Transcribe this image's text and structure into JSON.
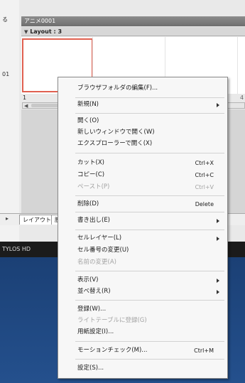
{
  "app": {
    "left_labels": [
      "る",
      "01"
    ],
    "title": "アニメ0001",
    "layout_label": "Layout : 3",
    "frame_number": "1",
    "frame_number_right": "4",
    "tab_label": "レイアウト",
    "tab2_label": "腕",
    "status_text": "TYLOS HD"
  },
  "context_menu": {
    "items": [
      {
        "label": "ブラウザフォルダの編集(F)...",
        "shortcut": "",
        "submenu": false,
        "disabled": false
      },
      {
        "label": "新規(N)",
        "shortcut": "",
        "submenu": true,
        "disabled": false
      },
      {
        "label": "開く(O)",
        "shortcut": "",
        "submenu": false,
        "disabled": false
      },
      {
        "label": "新しいウィンドウで開く(W)",
        "shortcut": "",
        "submenu": false,
        "disabled": false
      },
      {
        "label": "エクスプローラーで開く(X)",
        "shortcut": "",
        "submenu": false,
        "disabled": false
      },
      {
        "label": "カット(X)",
        "shortcut": "Ctrl+X",
        "submenu": false,
        "disabled": false
      },
      {
        "label": "コピー(C)",
        "shortcut": "Ctrl+C",
        "submenu": false,
        "disabled": false
      },
      {
        "label": "ペースト(P)",
        "shortcut": "Ctrl+V",
        "submenu": false,
        "disabled": true
      },
      {
        "label": "削除(D)",
        "shortcut": "Delete",
        "submenu": false,
        "disabled": false
      },
      {
        "label": "書き出し(E)",
        "shortcut": "",
        "submenu": true,
        "disabled": false
      },
      {
        "label": "セルレイヤー(L)",
        "shortcut": "",
        "submenu": true,
        "disabled": false
      },
      {
        "label": "セル番号の変更(U)",
        "shortcut": "",
        "submenu": false,
        "disabled": false
      },
      {
        "label": "名前の変更(A)",
        "shortcut": "",
        "submenu": false,
        "disabled": true
      },
      {
        "label": "表示(V)",
        "shortcut": "",
        "submenu": true,
        "disabled": false
      },
      {
        "label": "並べ替え(R)",
        "shortcut": "",
        "submenu": true,
        "disabled": false
      },
      {
        "label": "登録(W)...",
        "shortcut": "",
        "submenu": false,
        "disabled": false
      },
      {
        "label": "ライトテーブルに登録(G)",
        "shortcut": "",
        "submenu": false,
        "disabled": true
      },
      {
        "label": "用紙設定(I)...",
        "shortcut": "",
        "submenu": false,
        "disabled": false
      },
      {
        "label": "モーションチェック(M)...",
        "shortcut": "Ctrl+M",
        "submenu": false,
        "disabled": false
      },
      {
        "label": "設定(S)...",
        "shortcut": "",
        "submenu": false,
        "disabled": false
      }
    ]
  }
}
